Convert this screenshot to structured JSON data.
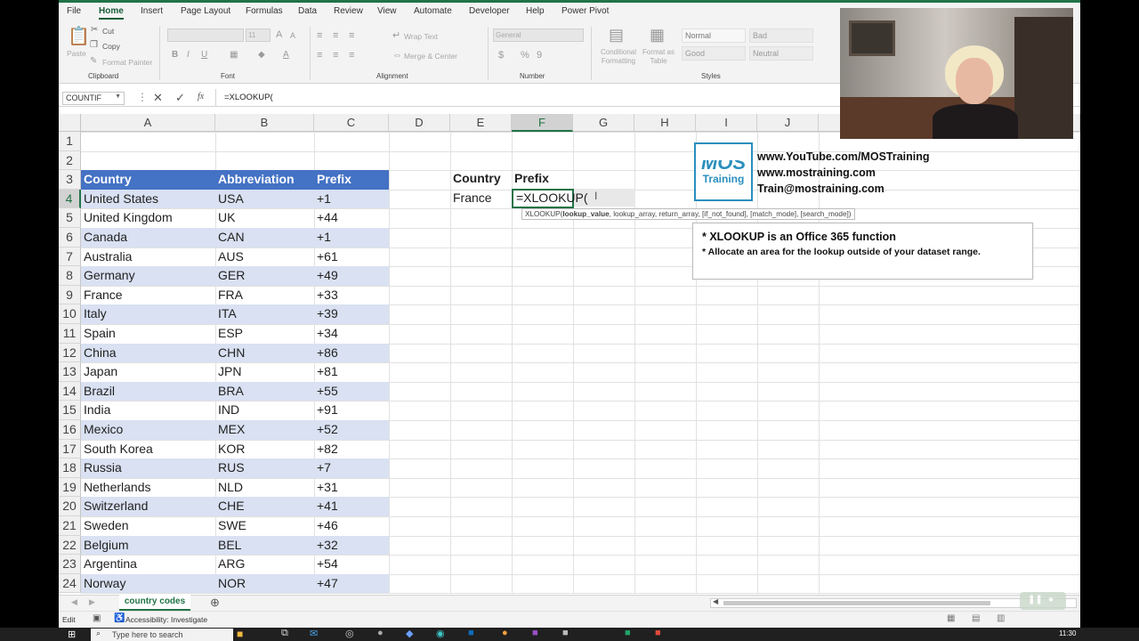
{
  "ribbon": {
    "tabs": [
      "File",
      "Home",
      "Insert",
      "Page Layout",
      "Formulas",
      "Data",
      "Review",
      "View",
      "Automate",
      "Developer",
      "Help",
      "Power Pivot"
    ],
    "active_tab": "Home",
    "clipboard": {
      "paste": "Paste",
      "cut": "Cut",
      "copy": "Copy",
      "format_painter": "Format Painter",
      "group": "Clipboard"
    },
    "font": {
      "size": "11",
      "group": "Font"
    },
    "alignment": {
      "wrap_text": "Wrap Text",
      "merge_center": "Merge & Center",
      "group": "Alignment"
    },
    "number": {
      "format": "General",
      "group": "Number"
    },
    "styles": {
      "conditional": "Conditional Formatting",
      "format_as_table": "Format as Table",
      "normal": "Normal",
      "bad": "Bad",
      "good": "Good",
      "neutral": "Neutral",
      "group": "Styles"
    }
  },
  "formula_bar": {
    "name_box": "COUNTIF",
    "fx": "fx",
    "formula": "=XLOOKUP("
  },
  "columns": [
    "A",
    "B",
    "C",
    "D",
    "E",
    "F",
    "G",
    "H",
    "I",
    "J"
  ],
  "selected_column": "F",
  "rows": [
    "1",
    "2",
    "3",
    "4",
    "5",
    "6",
    "7",
    "8",
    "9",
    "10",
    "11",
    "12",
    "13",
    "14",
    "15",
    "16",
    "17",
    "18",
    "19",
    "20",
    "21",
    "22",
    "23",
    "24"
  ],
  "selected_row": "4",
  "table": {
    "headers": [
      "Country",
      "Abbreviation",
      "Prefix"
    ],
    "rows": [
      [
        "United States",
        "USA",
        "+1"
      ],
      [
        "United Kingdom",
        "UK",
        "+44"
      ],
      [
        "Canada",
        "CAN",
        "+1"
      ],
      [
        "Australia",
        "AUS",
        "+61"
      ],
      [
        "Germany",
        "GER",
        "+49"
      ],
      [
        "France",
        "FRA",
        "+33"
      ],
      [
        "Italy",
        "ITA",
        "+39"
      ],
      [
        "Spain",
        "ESP",
        "+34"
      ],
      [
        "China",
        "CHN",
        "+86"
      ],
      [
        "Japan",
        "JPN",
        "+81"
      ],
      [
        "Brazil",
        "BRA",
        "+55"
      ],
      [
        "India",
        "IND",
        "+91"
      ],
      [
        "Mexico",
        "MEX",
        "+52"
      ],
      [
        "South Korea",
        "KOR",
        "+82"
      ],
      [
        "Russia",
        "RUS",
        "+7"
      ],
      [
        "Netherlands",
        "NLD",
        "+31"
      ],
      [
        "Switzerland",
        "CHE",
        "+41"
      ],
      [
        "Sweden",
        "SWE",
        "+46"
      ],
      [
        "Belgium",
        "BEL",
        "+32"
      ],
      [
        "Argentina",
        "ARG",
        "+54"
      ],
      [
        "Norway",
        "NOR",
        "+47"
      ]
    ]
  },
  "lookup": {
    "label_country": "Country",
    "label_prefix": "Prefix",
    "value_country": "France",
    "formula": "=XLOOKUP("
  },
  "tooltip": {
    "fn": "XLOOKUP(",
    "bold": "lookup_value",
    "rest": ", lookup_array, return_array, [if_not_found], [match_mode], [search_mode])"
  },
  "branding": {
    "logo_top": "MOS",
    "logo_bottom": "Training",
    "line1": "www.YouTube.com/MOSTraining",
    "line2": "www.mostraining.com",
    "line3": "Train@mostraining.com"
  },
  "notes": {
    "line1": "* XLOOKUP is an Office 365 function",
    "line2": "* Allocate an area for the lookup outside of your dataset range."
  },
  "sheet_tab": "country codes",
  "status": {
    "mode": "Edit",
    "accessibility": "Accessibility: Investigate"
  },
  "taskbar": {
    "search_placeholder": "Type here to search",
    "time": "11:30"
  },
  "colors": {
    "accent": "#217346",
    "table_header": "#4472c4",
    "table_band": "#d9e1f2"
  }
}
